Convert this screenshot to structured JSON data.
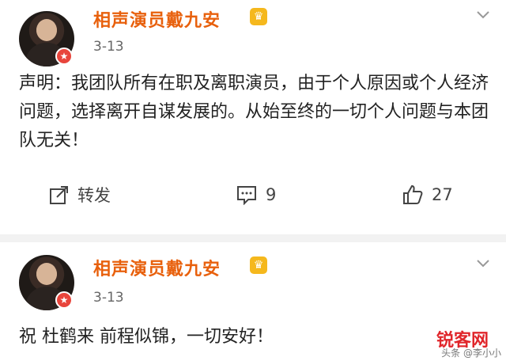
{
  "posts": [
    {
      "author": "相声演员戴九安",
      "vip_icon": "crown-vip-badge",
      "verify_icon": "verified-star-badge",
      "date": "3-13",
      "content": "声明：我团队所有在职及离职演员，由于个人原因或个人经济问题，选择离开自谋发展的。从始至终的一切个人问题与本团队无关！",
      "actions": {
        "repost_label": "转发",
        "comment_count": "9",
        "like_count": "27"
      }
    },
    {
      "author": "相声演员戴九安",
      "vip_icon": "crown-vip-badge",
      "verify_icon": "verified-star-badge",
      "date": "3-13",
      "content": "祝 杜鹤来 前程似锦，一切安好！"
    }
  ],
  "watermark": {
    "site": "锐客网",
    "source": "头条 @李小小"
  },
  "colors": {
    "author_name": "#e8600c",
    "vip": "#f5b81d",
    "verified": "#e8453c",
    "divider": "#f2f2f2"
  }
}
